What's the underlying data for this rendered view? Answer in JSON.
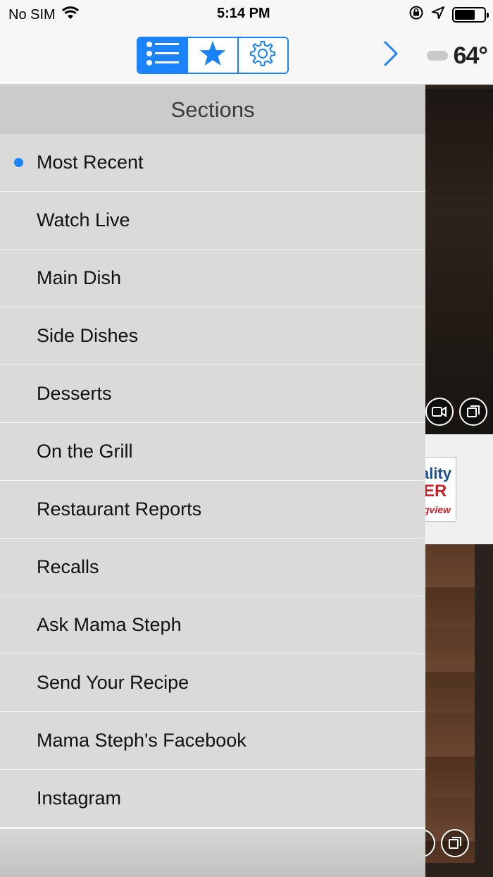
{
  "status_bar": {
    "carrier": "No SIM",
    "time": "5:14 PM"
  },
  "toolbar": {
    "tabs": [
      {
        "icon": "list-icon",
        "selected": true
      },
      {
        "icon": "star-icon",
        "selected": false
      },
      {
        "icon": "gear-icon",
        "selected": false
      }
    ],
    "next_icon": "chevron-right-icon"
  },
  "background": {
    "temperature": "64°"
  },
  "sections": {
    "title": "Sections",
    "items": [
      {
        "label": "Most Recent",
        "selected": true
      },
      {
        "label": "Watch Live"
      },
      {
        "label": "Main Dish"
      },
      {
        "label": "Side Dishes"
      },
      {
        "label": "Desserts"
      },
      {
        "label": "On the Grill"
      },
      {
        "label": "Restaurant Reports"
      },
      {
        "label": "Recalls"
      },
      {
        "label": "Ask Mama Steph"
      },
      {
        "label": "Send Your Recipe"
      },
      {
        "label": "Mama Steph's Facebook"
      },
      {
        "label": "Instagram"
      }
    ]
  },
  "colors": {
    "accent": "#1a82fb",
    "menu_bg": "#dadad9",
    "header_bg": "#cbcbcb"
  }
}
